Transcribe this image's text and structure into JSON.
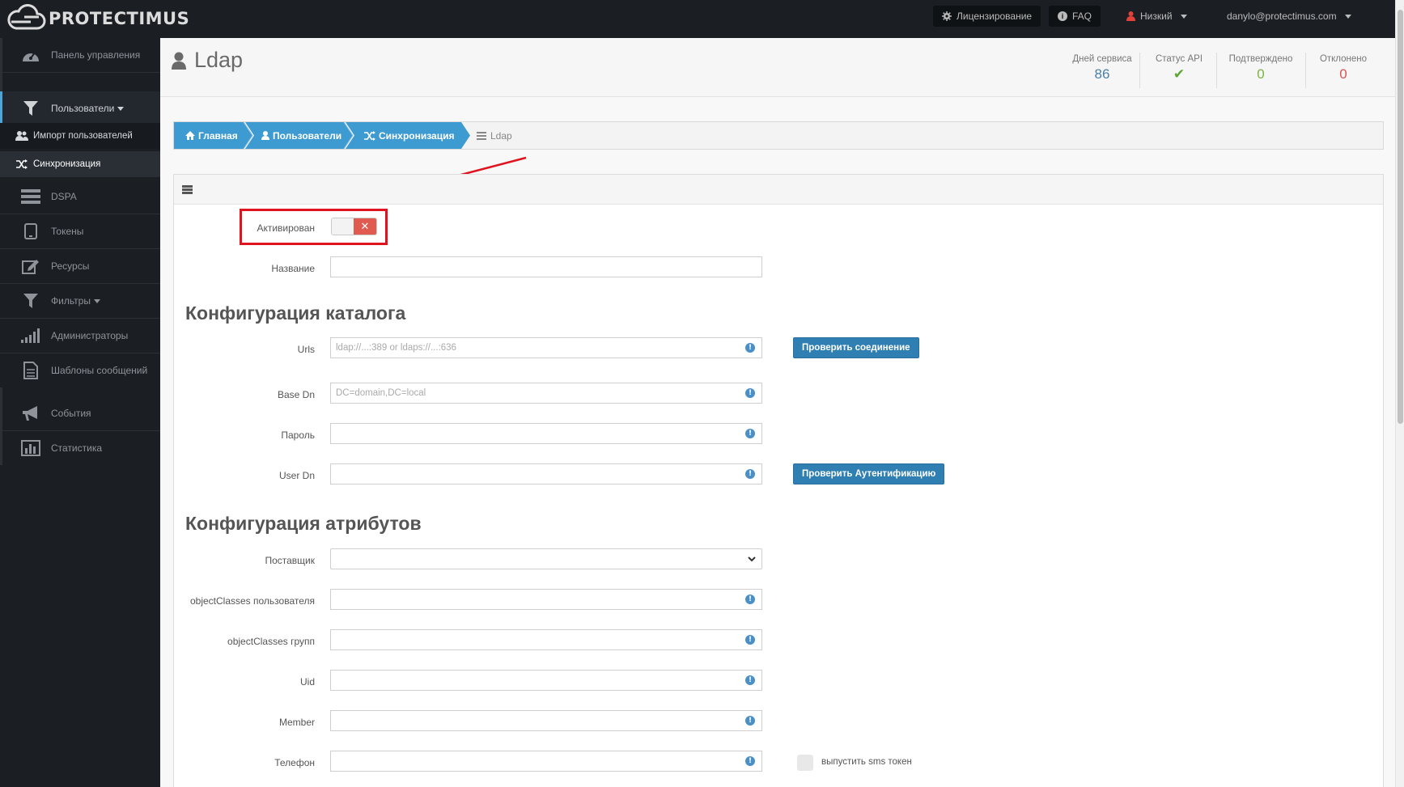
{
  "app": {
    "logo_text": "PROTECTIMUS"
  },
  "topbar": {
    "licensing_label": "Лицензирование",
    "faq_label": "FAQ",
    "risk_label": "Низкий",
    "user_email": "danylo@protectimus.com"
  },
  "sidebar": {
    "items": [
      {
        "label": "Панель управления",
        "icon": "dashboard-icon"
      },
      {
        "label": "Пользователи",
        "icon": "filter-icon"
      },
      {
        "label": "Импорт пользователей",
        "icon": "users-icon"
      },
      {
        "label": "Синхронизация",
        "icon": "shuffle-icon"
      },
      {
        "label": "DSPA",
        "icon": "server-icon"
      },
      {
        "label": "Токены",
        "icon": "tablet-icon"
      },
      {
        "label": "Ресурсы",
        "icon": "edit-icon"
      },
      {
        "label": "Фильтры",
        "icon": "filter-icon"
      },
      {
        "label": "Администраторы",
        "icon": "signal-icon"
      },
      {
        "label": "Шаблоны сообщений",
        "icon": "document-icon"
      },
      {
        "label": "События",
        "icon": "megaphone-icon"
      },
      {
        "label": "Статистика",
        "icon": "bar-chart-icon"
      }
    ]
  },
  "header": {
    "title": "Ldap",
    "stats": [
      {
        "label": "Дней сервиса",
        "value": "86",
        "color": "#4a7fa8"
      },
      {
        "label": "Статус API",
        "value": "✔",
        "color": "#5aa632"
      },
      {
        "label": "Подтверждено",
        "value": "0",
        "color": "#7cb342"
      },
      {
        "label": "Отклонено",
        "value": "0",
        "color": "#d9534f"
      }
    ]
  },
  "breadcrumb": {
    "home": "Главная",
    "users": "Пользователи",
    "sync": "Синхронизация",
    "current": "Ldap"
  },
  "form": {
    "activated_label": "Активирован",
    "name_label": "Название",
    "catalog_title": "Конфигурация каталога",
    "urls_label": "Urls",
    "urls_placeholder": "ldap://...:389 or ldaps://...:636",
    "check_connection": "Проверить соединение",
    "basedn_label": "Base Dn",
    "basedn_placeholder": "DC=domain,DC=local",
    "password_label": "Пароль",
    "userdn_label": "User Dn",
    "check_auth": "Проверить Аутентификацию",
    "attributes_title": "Конфигурация атрибутов",
    "provider_label": "Поставщик",
    "user_objectclasses_label": "objectClasses пользователя",
    "group_objectclasses_label": "objectClasses групп",
    "uid_label": "Uid",
    "member_label": "Member",
    "phone_label": "Телефон",
    "issue_sms_label": "выпустить sms токен"
  }
}
